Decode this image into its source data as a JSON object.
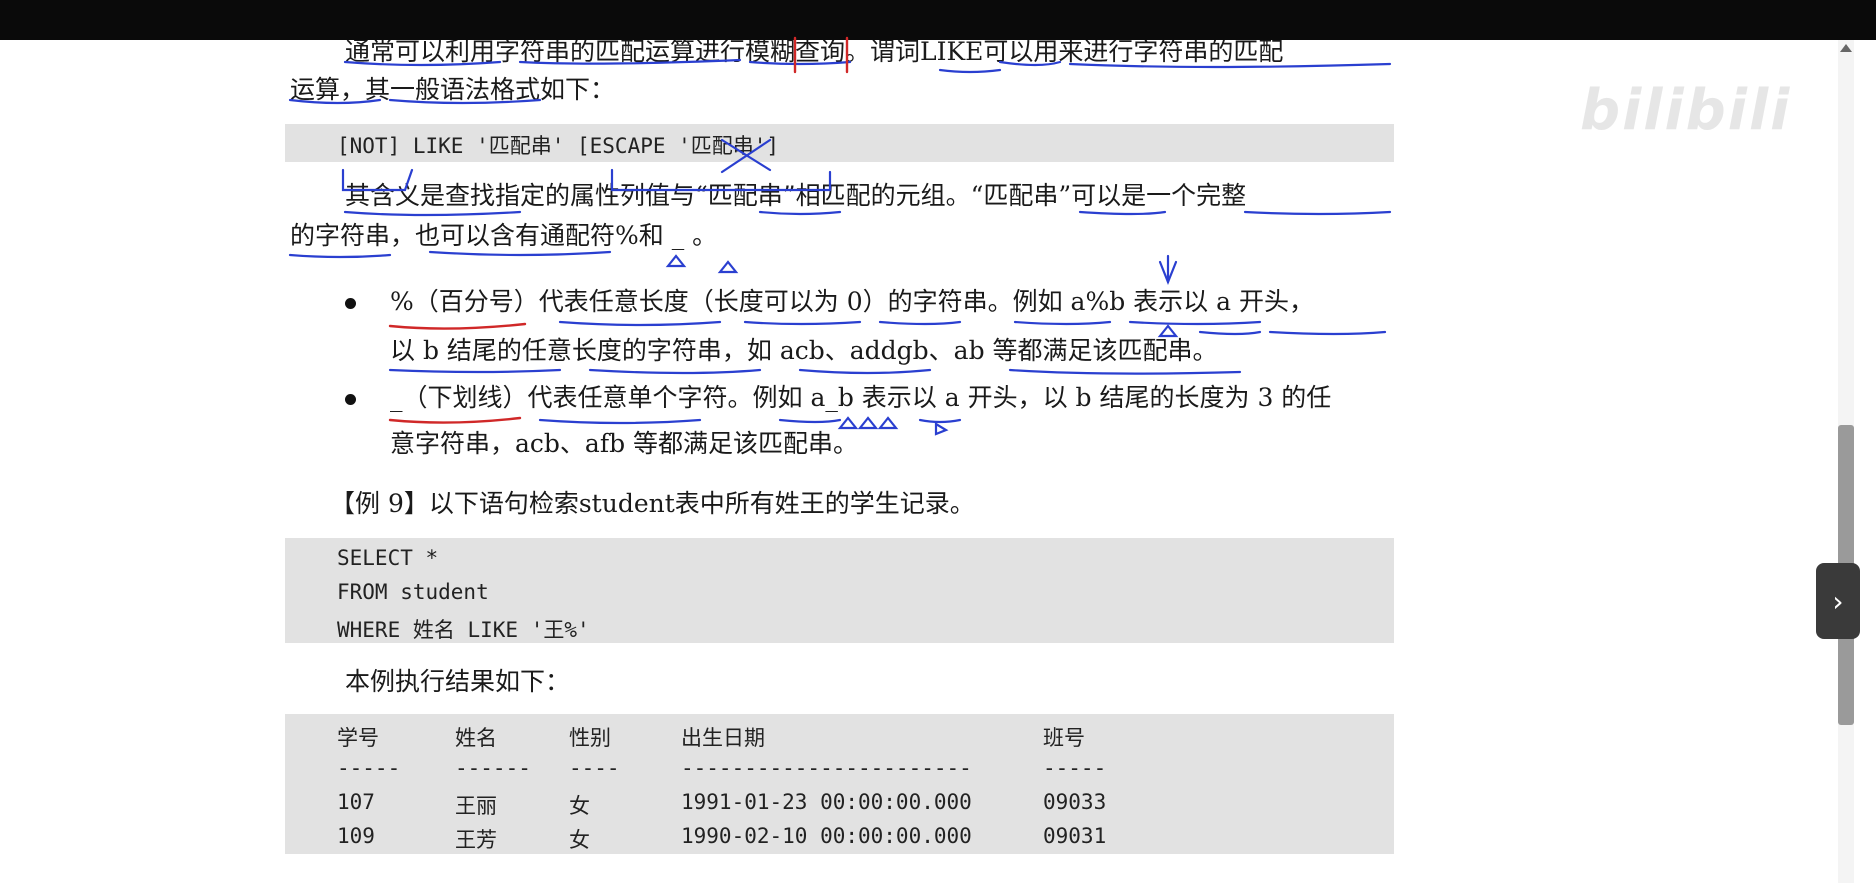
{
  "document": {
    "para1_line1": "通常可以利用字符串的匹配运算进行模糊查询。谓词LIKE可以用来进行字符串的匹配",
    "para1_line2": "运算，其一般语法格式如下：",
    "syntax": "[NOT] LIKE '匹配串' [ESCAPE '匹配串']",
    "para2_line1": "其含义是查找指定的属性列值与“匹配串”相匹配的元组。“匹配串”可以是一个完整",
    "para2_line2": "的字符串，也可以含有通配符%和 _ 。",
    "bullet1_line1": "%（百分号）代表任意长度（长度可以为 0）的字符串。例如 a%b 表示以 a 开头，",
    "bullet1_line2": "以 b 结尾的任意长度的字符串，如 acb、addgb、ab 等都满足该匹配串。",
    "bullet2_line1": "_（下划线）代表任意单个字符。例如 a_b 表示以 a 开头，以 b 结尾的长度为 3 的任",
    "bullet2_line2": "意字符串，acb、afb 等都满足该匹配串。",
    "example_heading": "【例 9】以下语句检索student表中所有姓王的学生记录。",
    "code": [
      "SELECT *",
      "FROM student",
      "WHERE 姓名 LIKE '王%'"
    ],
    "result_intro": "本例执行结果如下：",
    "result_table": {
      "headers": [
        "学号",
        "姓名",
        "性别",
        "出生日期",
        "班号"
      ],
      "separators": [
        "-----",
        "------",
        "----",
        "-----------------------",
        "-----"
      ],
      "rows": [
        [
          "107",
          "王丽",
          "女",
          "1991-01-23 00:00:00.000",
          "09033"
        ],
        [
          "109",
          "王芳",
          "女",
          "1990-02-10 00:00:00.000",
          "09031"
        ]
      ]
    }
  },
  "player": {
    "watermark_brand": "bilibili",
    "next_icon": "chevron-right-icon"
  },
  "colors": {
    "annotation_blue": "#2a3fd0",
    "annotation_red": "#d02828",
    "code_background": "#e2e2e2",
    "top_bar": "#0a0a0a"
  }
}
